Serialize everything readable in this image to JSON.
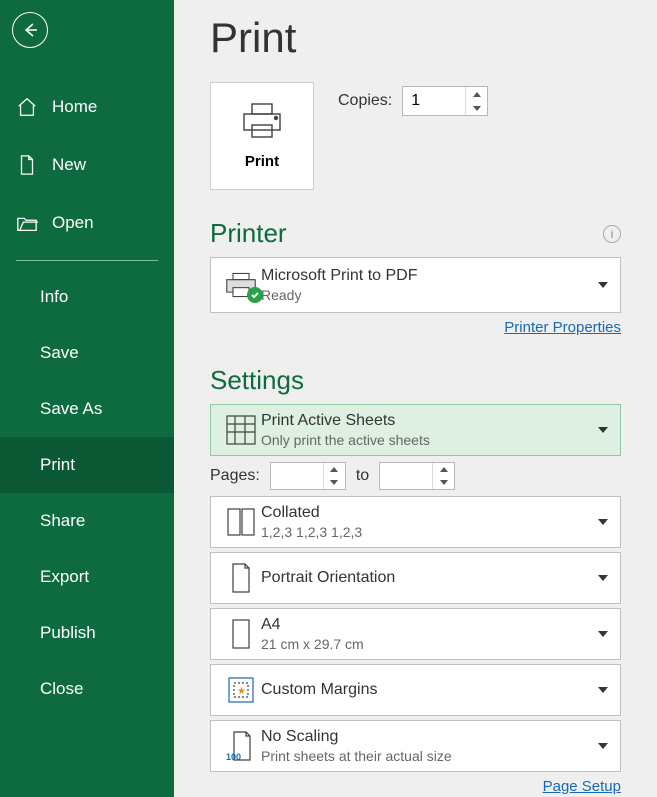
{
  "sidebar": {
    "items": [
      {
        "label": "Home"
      },
      {
        "label": "New"
      },
      {
        "label": "Open"
      }
    ],
    "subs": [
      {
        "label": "Info"
      },
      {
        "label": "Save"
      },
      {
        "label": "Save As"
      },
      {
        "label": "Print"
      },
      {
        "label": "Share"
      },
      {
        "label": "Export"
      },
      {
        "label": "Publish"
      },
      {
        "label": "Close"
      }
    ]
  },
  "page": {
    "title": "Print",
    "print_button_label": "Print",
    "copies_label": "Copies:",
    "copies_value": "1"
  },
  "printer": {
    "heading": "Printer",
    "name": "Microsoft Print to PDF",
    "status": "Ready",
    "properties_link": "Printer Properties"
  },
  "settings": {
    "heading": "Settings",
    "active_sheets_title": "Print Active Sheets",
    "active_sheets_sub": "Only print the active sheets",
    "pages_label": "Pages:",
    "pages_from": "",
    "pages_to_label": "to",
    "pages_to": "",
    "collated_title": "Collated",
    "collated_sub": "1,2,3    1,2,3    1,2,3",
    "orientation_title": "Portrait Orientation",
    "paper_title": "A4",
    "paper_sub": "21 cm x 29.7 cm",
    "margins_title": "Custom Margins",
    "scaling_title": "No Scaling",
    "scaling_sub": "Print sheets at their actual size",
    "scaling_num": "100",
    "page_setup_link": "Page Setup"
  }
}
